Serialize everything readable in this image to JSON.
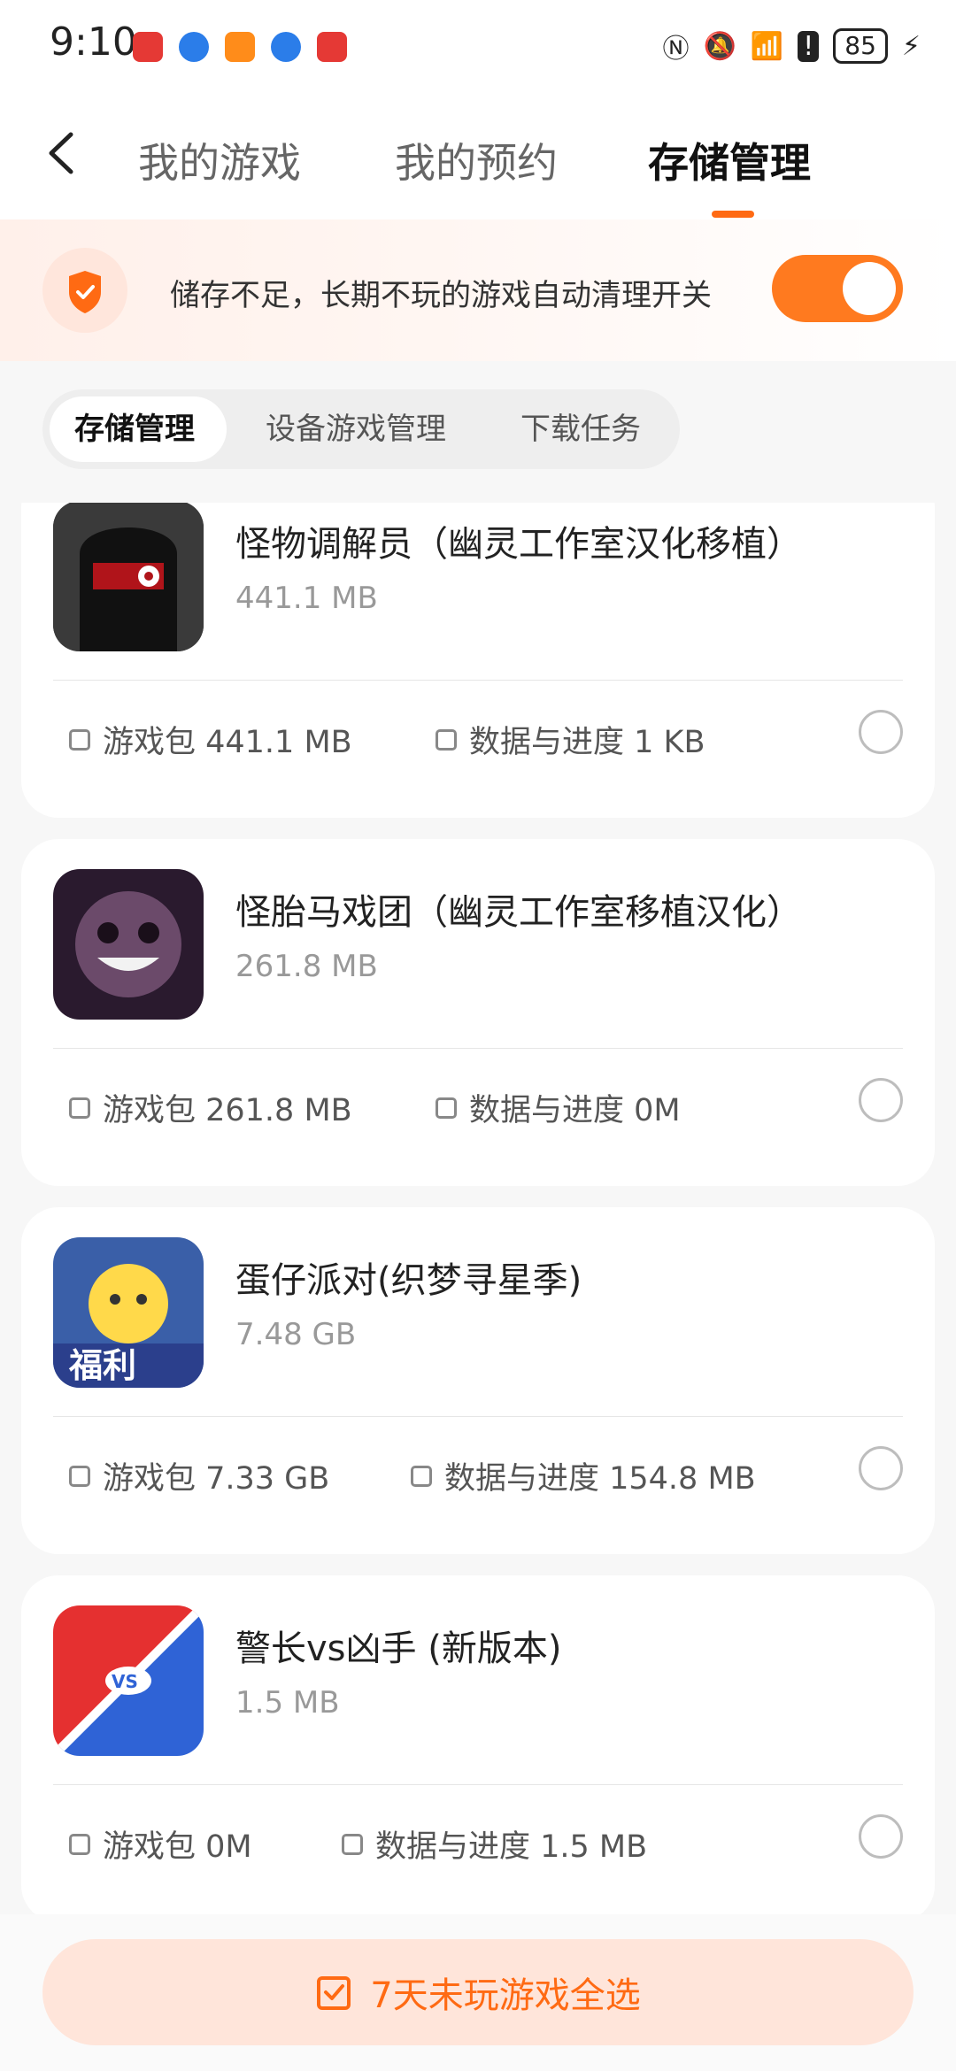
{
  "status_bar": {
    "time": "9:10",
    "battery": "85",
    "icons": [
      "nfc-icon",
      "mute-icon",
      "wifi-icon",
      "alert-icon",
      "charging-icon"
    ]
  },
  "header": {
    "tabs": [
      {
        "label": "我的游戏",
        "active": false
      },
      {
        "label": "我的预约",
        "active": false
      },
      {
        "label": "存储管理",
        "active": true
      }
    ]
  },
  "banner": {
    "text": "储存不足，长期不玩的游戏自动清理开关",
    "toggle_on": true
  },
  "segments": {
    "items": [
      {
        "label": "存储管理",
        "active": true
      },
      {
        "label": "设备游戏管理",
        "active": false
      },
      {
        "label": "下载任务",
        "active": false
      }
    ]
  },
  "games": [
    {
      "name": "怪物调解员（幽灵工作室汉化移植）",
      "size": "441.1 MB",
      "package": "游戏包 441.1 MB",
      "data": "数据与进度 1 KB"
    },
    {
      "name": "怪胎马戏团（幽灵工作室移植汉化）",
      "size": "261.8 MB",
      "package": "游戏包 261.8 MB",
      "data": "数据与进度 0M"
    },
    {
      "name": "蛋仔派对(织梦寻星季)",
      "size": "7.48 GB",
      "package": "游戏包 7.33 GB",
      "data": "数据与进度 154.8 MB",
      "icon_badge": "福利"
    },
    {
      "name": "警长vs凶手 (新版本)",
      "size": "1.5 MB",
      "package": "游戏包 0M",
      "data": "数据与进度 1.5 MB",
      "icon_badge": "VS"
    }
  ],
  "bottom": {
    "select_label": "7天未玩游戏全选"
  },
  "colors": {
    "accent": "#ff6a13",
    "toggle": "#ff7a1f",
    "cta_bg": "#ffe5da"
  }
}
